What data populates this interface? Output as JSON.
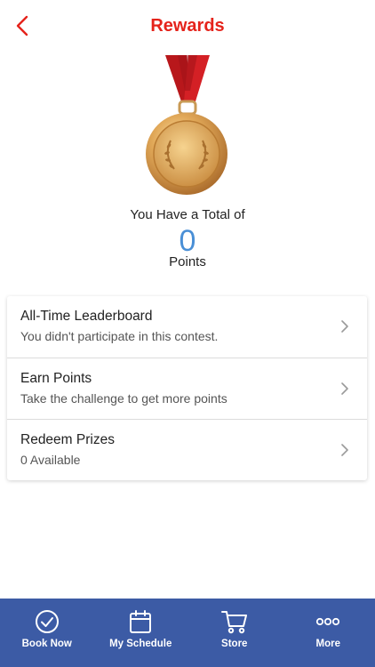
{
  "header": {
    "title": "Rewards"
  },
  "summary": {
    "total_label": "You Have a Total of",
    "points": "0",
    "points_label": "Points"
  },
  "menu": [
    {
      "title": "All-Time Leaderboard",
      "subtitle": "You didn't participate in this contest."
    },
    {
      "title": "Earn Points",
      "subtitle": "Take the challenge to get more points"
    },
    {
      "title": "Redeem Prizes",
      "subtitle": "0 Available"
    }
  ],
  "tabs": [
    {
      "label": "Book Now",
      "icon": "check-circle-icon"
    },
    {
      "label": "My Schedule",
      "icon": "calendar-icon"
    },
    {
      "label": "Store",
      "icon": "cart-icon"
    },
    {
      "label": "More",
      "icon": "more-dots-icon"
    }
  ],
  "colors": {
    "accent": "#e5231b",
    "points": "#4a8fd6",
    "tabbar": "#3c5ba5"
  }
}
